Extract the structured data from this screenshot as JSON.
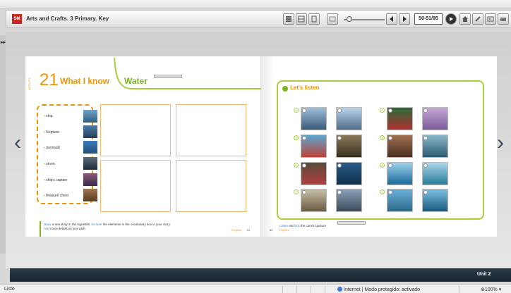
{
  "app": {
    "title": "Arts and Crafts. 3 Primary. Key",
    "logo_text": "SM",
    "page_indicator": "50-51/95"
  },
  "book": {
    "left_page": {
      "activity_label": "ACTIVITY",
      "unit_number": "21",
      "section_title": "What I know",
      "topic_title": "Water",
      "vocab": [
        {
          "label": "ship"
        },
        {
          "label": "Neptune"
        },
        {
          "label": "mermaid"
        },
        {
          "label": "storm"
        },
        {
          "label": "ship's captain"
        },
        {
          "label": "treasure chest"
        }
      ],
      "instructions_line1_a": "Draw",
      "instructions_line1_b": " a sea story in the vignettes. ",
      "instructions_line1_c": "Include",
      "instructions_line1_d": " the elements in the vocabulary box in your story.",
      "instructions_line2_a": "Add",
      "instructions_line2_b": " more details as you wish.",
      "footer_brand": "Rhythm",
      "page_number": "51"
    },
    "right_page": {
      "listen_title": "Let's listen",
      "numbers": [
        "1",
        "2",
        "3",
        "4",
        "5",
        "6",
        "7",
        "8"
      ],
      "instructions_a": "Listen",
      "instructions_b": " and ",
      "instructions_c": "tick",
      "instructions_d": " the correct picture.",
      "footer_brand": "Rhythm",
      "page_number": "82"
    }
  },
  "bottom": {
    "unit_label": "Unit 2"
  },
  "status": {
    "left_text": "Listo",
    "zone_text": "Internet | Modo protegido: activado",
    "zoom_text": "100%"
  },
  "colors": {
    "accent_orange": "#f39200",
    "accent_green": "#7ab51d",
    "bottom_bar": "#1e2e3c"
  }
}
